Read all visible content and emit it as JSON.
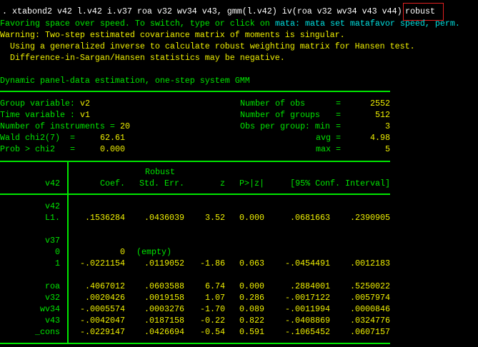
{
  "command": {
    "prefix": ". xtabond2 v42 l.v42 i.v37 roa v32 wv34 v43, gmm(l.v42) iv(roa v32 wv34 v43 v44)",
    "highlighted_option": "robust"
  },
  "messages": {
    "favoring": "Favoring space over speed. To switch, type or click on",
    "mata_link": "mata: mata set matafavor speed, perm.",
    "warning": "Warning: Two-step estimated covariance matrix of moments is singular.",
    "warning2": "Using a generalized inverse to calculate robust weighting matrix for Hansen test.",
    "warning3": "Difference-in-Sargan/Hansen statistics may be negative."
  },
  "title": "Dynamic panel-data estimation, one-step system GMM",
  "header": {
    "group_var_label": "Group variable:",
    "group_var": "v2",
    "time_var_label": "Time variable :",
    "time_var": "v1",
    "instruments_label": "Number of instruments =",
    "instruments": "20",
    "wald_label": "Wald chi2(7)",
    "wald": "62.61",
    "prob_label": "Prob > chi2",
    "prob": "0.000",
    "eq": "=",
    "nobs_label": "Number of obs",
    "nobs": "2552",
    "ngroups_label": "Number of groups",
    "ngroups": "512",
    "min_label": "Obs per group: min",
    "min": "3",
    "avg_label": "avg",
    "avg": "4.98",
    "max_label": "max",
    "max": "5"
  },
  "table": {
    "robust": "Robust",
    "headers": [
      "v42",
      "Coef.",
      "Std. Err.",
      "z",
      "P>|z|",
      "[95% Conf. Interval]"
    ],
    "rows": [
      {
        "name": "v42"
      },
      {
        "name": "L1.",
        "v": [
          ".1536284",
          ".0436039",
          "3.52",
          "0.000",
          ".0681663",
          ".2390905"
        ]
      },
      {
        "name": "v37"
      },
      {
        "name": "0",
        "coef": "0",
        "note": "(empty)"
      },
      {
        "name": "1",
        "v": [
          "-.0221154",
          ".0119052",
          "-1.86",
          "0.063",
          "-.0454491",
          ".0012183"
        ]
      },
      {
        "name": "roa",
        "v": [
          ".4067012",
          ".0603588",
          "6.74",
          "0.000",
          ".2884001",
          ".5250022"
        ]
      },
      {
        "name": "v32",
        "v": [
          ".0020426",
          ".0019158",
          "1.07",
          "0.286",
          "-.0017122",
          ".0057974"
        ]
      },
      {
        "name": "wv34",
        "v": [
          "-.0005574",
          ".0003276",
          "-1.70",
          "0.089",
          "-.0011994",
          ".0000846"
        ]
      },
      {
        "name": "v43",
        "v": [
          "-.0042047",
          ".0187158",
          "-0.22",
          "0.822",
          "-.0408869",
          ".0324776"
        ]
      },
      {
        "name": "_cons",
        "v": [
          "-.0229147",
          ".0426694",
          "-0.54",
          "0.591",
          "-.1065452",
          ".0607157"
        ]
      }
    ]
  }
}
